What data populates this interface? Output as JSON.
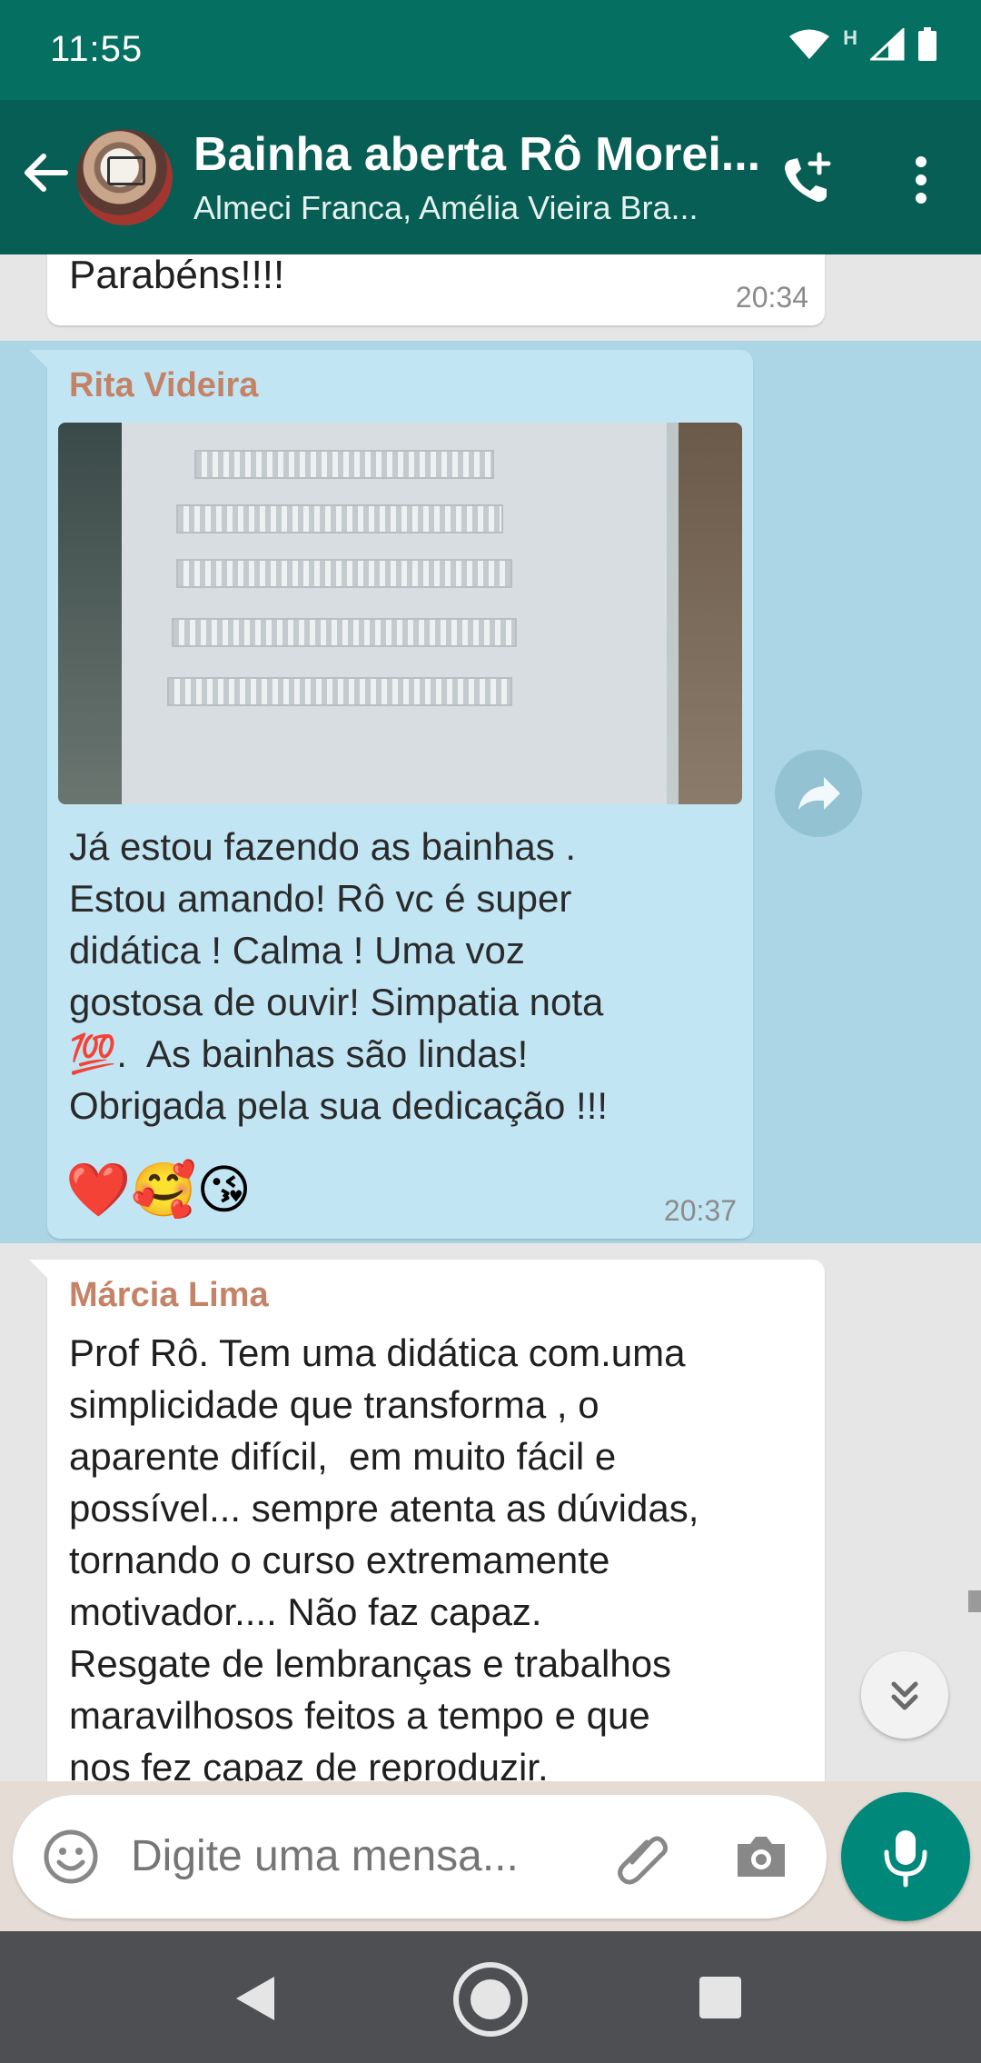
{
  "status_bar": {
    "time": "11:55",
    "network_label": "H"
  },
  "header": {
    "title": "Bainha aberta Rô Morei...",
    "subtitle": "Almeci Franca, Amélia Vieira Bra..."
  },
  "messages": [
    {
      "text": "Parabéns!!!!",
      "time": "20:34"
    },
    {
      "sender": "Rita Videira",
      "has_image": true,
      "text": "Já estou fazendo as bainhas .\nEstou amando! Rô vc é super\ndidática ! Calma ! Uma voz\ngostosa de ouvir! Simpatia nota\n💯.  As bainhas são lindas!\nObrigada pela sua dedicação !!!",
      "emojis": "❤️🥰😘",
      "time": "20:37"
    },
    {
      "sender": "Márcia Lima",
      "text": "Prof Rô. Tem uma didática com.uma\nsimplicidade que transforma , o\naparente difícil,  em muito fácil e\npossível... sempre atenta as dúvidas,\ntornando o curso extremamente\nmotivador.... Não faz capaz.\nResgate de lembranças e trabalhos\nmaravilhosos feitos a tempo e que\nnos fez capaz de reproduzir."
    }
  ],
  "composer": {
    "placeholder": "Digite uma mensa..."
  },
  "colors": {
    "header": "#075e54",
    "status_bar": "#056f62",
    "accent": "#00897b",
    "sender_name": "#c48266",
    "selected_bubble": "#c2e5f4",
    "selection_highlight": "#acd6e6"
  }
}
